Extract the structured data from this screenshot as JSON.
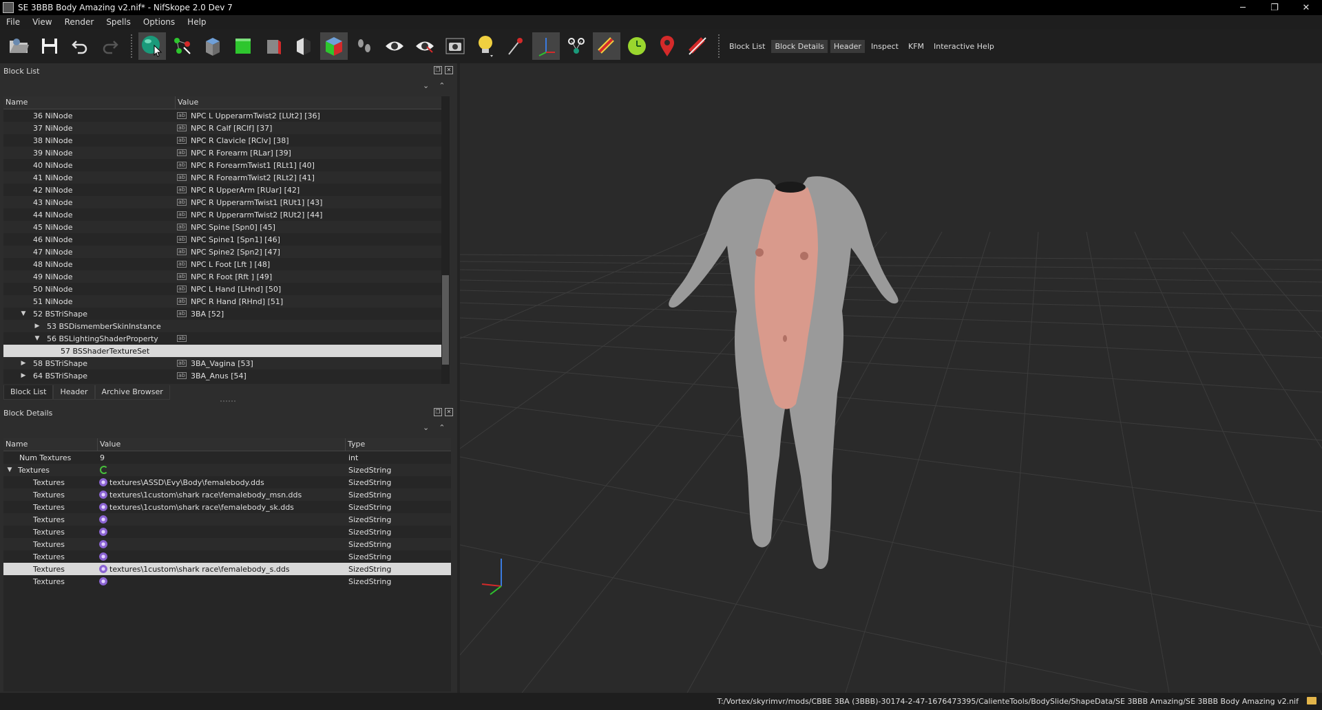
{
  "window": {
    "title": "SE 3BBB Body Amazing v2.nif* - NifSkope 2.0 Dev 7",
    "minimize": "─",
    "restore": "❐",
    "close": "✕"
  },
  "menu": [
    "File",
    "View",
    "Render",
    "Spells",
    "Options",
    "Help"
  ],
  "toolbar": {
    "text_buttons": [
      "Block List",
      "Block Details",
      "Header",
      "Inspect",
      "KFM",
      "Interactive Help"
    ],
    "colors": {
      "accent_green": "#2ec62e",
      "red": "#d42a2a",
      "yellow": "#f0d040",
      "teal": "#1a9a7a"
    }
  },
  "block_list": {
    "title": "Block List",
    "col_name": "Name",
    "col_value": "Value",
    "rows": [
      {
        "name": "36 NiNode",
        "value": "NPC L UpperarmTwist2 [LUt2] [36]"
      },
      {
        "name": "37 NiNode",
        "value": "NPC R Calf [RClf] [37]"
      },
      {
        "name": "38 NiNode",
        "value": "NPC R Clavicle [RClv] [38]"
      },
      {
        "name": "39 NiNode",
        "value": "NPC R Forearm [RLar] [39]"
      },
      {
        "name": "40 NiNode",
        "value": "NPC R ForearmTwist1 [RLt1] [40]"
      },
      {
        "name": "41 NiNode",
        "value": "NPC R ForearmTwist2 [RLt2] [41]"
      },
      {
        "name": "42 NiNode",
        "value": "NPC R UpperArm [RUar] [42]"
      },
      {
        "name": "43 NiNode",
        "value": "NPC R UpperarmTwist1 [RUt1] [43]"
      },
      {
        "name": "44 NiNode",
        "value": "NPC R UpperarmTwist2 [RUt2] [44]"
      },
      {
        "name": "45 NiNode",
        "value": "NPC Spine [Spn0] [45]"
      },
      {
        "name": "46 NiNode",
        "value": "NPC Spine1 [Spn1] [46]"
      },
      {
        "name": "47 NiNode",
        "value": "NPC Spine2 [Spn2] [47]"
      },
      {
        "name": "48 NiNode",
        "value": "NPC L Foot [Lft ] [48]"
      },
      {
        "name": "49 NiNode",
        "value": "NPC R Foot [Rft ] [49]"
      },
      {
        "name": "50 NiNode",
        "value": "NPC L Hand [LHnd] [50]"
      },
      {
        "name": "51 NiNode",
        "value": "NPC R Hand [RHnd] [51]"
      },
      {
        "name": "52 BSTriShape",
        "value": "3BA [52]"
      },
      {
        "name": "53 BSDismemberSkinInstance",
        "value": ""
      },
      {
        "name": "56 BSLightingShaderProperty",
        "value": ""
      },
      {
        "name": "57 BSShaderTextureSet",
        "value": ""
      },
      {
        "name": "58 BSTriShape",
        "value": "3BA_Vagina [53]"
      },
      {
        "name": "64 BSTriShape",
        "value": "3BA_Anus [54]"
      }
    ],
    "tabs": [
      "Block List",
      "Header",
      "Archive Browser"
    ]
  },
  "block_details": {
    "title": "Block Details",
    "col_name": "Name",
    "col_value": "Value",
    "col_type": "Type",
    "rows": [
      {
        "name": "Num Textures",
        "value": "9",
        "type": "int"
      },
      {
        "name": "Textures",
        "value": "",
        "type": "SizedString"
      },
      {
        "name": "Textures",
        "value": "textures\\ASSD\\Evy\\Body\\femalebody.dds",
        "type": "SizedString"
      },
      {
        "name": "Textures",
        "value": "textures\\1custom\\shark race\\femalebody_msn.dds",
        "type": "SizedString"
      },
      {
        "name": "Textures",
        "value": "textures\\1custom\\shark race\\femalebody_sk.dds",
        "type": "SizedString"
      },
      {
        "name": "Textures",
        "value": "",
        "type": "SizedString"
      },
      {
        "name": "Textures",
        "value": "",
        "type": "SizedString"
      },
      {
        "name": "Textures",
        "value": "",
        "type": "SizedString"
      },
      {
        "name": "Textures",
        "value": "",
        "type": "SizedString"
      },
      {
        "name": "Textures",
        "value": "textures\\1custom\\shark race\\femalebody_s.dds",
        "type": "SizedString"
      },
      {
        "name": "Textures",
        "value": "",
        "type": "SizedString"
      }
    ]
  },
  "viewport": {
    "background": "#2a2a2a",
    "grid_color": "#3c3c3c",
    "body_color": "#9a9a9a",
    "skin_color": "#d99a8c"
  },
  "status": {
    "path": "T:/Vortex/skyrimvr/mods/CBBE 3BA (3BBB)-30174-2-47-1676473395/CalienteTools/BodySlide/ShapeData/SE 3BBB Amazing/SE 3BBB Body Amazing v2.nif"
  }
}
